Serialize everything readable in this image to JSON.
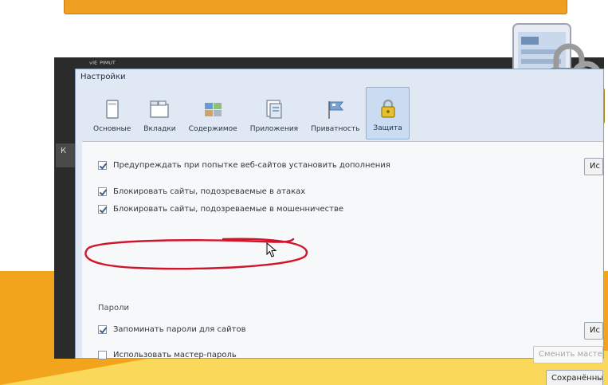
{
  "dark_window": {
    "title": "ᵛᴵᴱ ᴾᴵᴹᵁᵀ",
    "side_label": "К"
  },
  "dialog": {
    "title": "Настройки",
    "tabs": [
      {
        "label": "Основные",
        "icon": "general-icon",
        "active": false
      },
      {
        "label": "Вкладки",
        "icon": "tabs-icon",
        "active": false
      },
      {
        "label": "Содержимое",
        "icon": "content-icon",
        "active": false
      },
      {
        "label": "Приложения",
        "icon": "applications-icon",
        "active": false
      },
      {
        "label": "Приватность",
        "icon": "privacy-icon",
        "active": false
      },
      {
        "label": "Защита",
        "icon": "padlock-icon",
        "active": true
      }
    ],
    "options": {
      "warn_addons": {
        "label": "Предупреждать при попытке веб-сайтов установить дополнения",
        "checked": true
      },
      "block_attack": {
        "label": "Блокировать сайты, подозреваемые в атаках",
        "checked": true
      },
      "block_fraud": {
        "label": "Блокировать сайты, подозреваемые в мошенничестве",
        "checked": true
      }
    },
    "passwords_section": "Пароли",
    "remember_passwords": {
      "label": "Запоминать пароли для сайтов",
      "checked": true
    },
    "master_password": {
      "label": "Использовать мастер-пароль",
      "checked": false
    },
    "buttons": {
      "exceptions_1": "Ис",
      "exceptions_2": "Ис",
      "change_master": "Сменить мастер",
      "saved": "Сохранённые"
    }
  },
  "colors": {
    "banner": "#f0a020",
    "slide_orange": "#f2a51c",
    "slide_yellow": "#f9d85a",
    "annotation": "#d0152b"
  }
}
